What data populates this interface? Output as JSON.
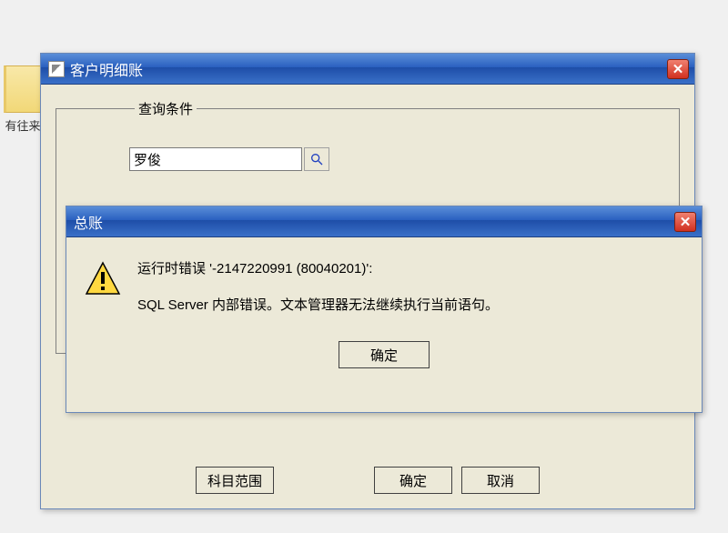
{
  "desktop": {
    "icon_label": "有往来"
  },
  "main_window": {
    "title": "客户明细账",
    "fieldset_legend": "查询条件",
    "search_value": "罗俊",
    "buttons": {
      "scope": "科目范围",
      "ok": "确定",
      "cancel": "取消"
    }
  },
  "error_dialog": {
    "title": "总账",
    "line1": "运行时错误 '-2147220991 (80040201)':",
    "line2": "SQL Server 内部错误。文本管理器无法继续执行当前语句。",
    "ok": "确定"
  }
}
